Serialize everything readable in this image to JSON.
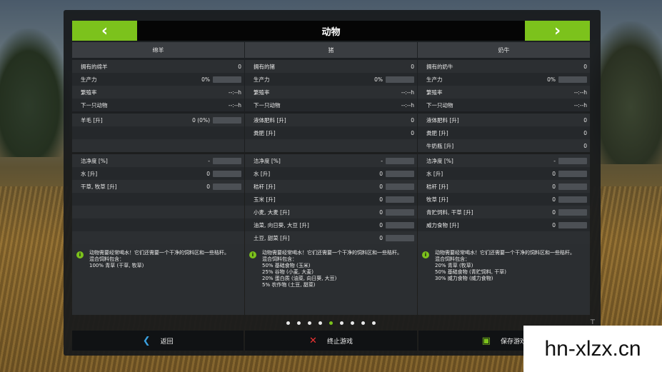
{
  "header": {
    "title": "动物",
    "prev_glyph": "‹",
    "next_glyph": "›"
  },
  "columns": [
    {
      "name": "绵羊",
      "stats": [
        {
          "label": "拥有的绵羊",
          "value": "0",
          "bar": false
        },
        {
          "label": "生产力",
          "value": "0%",
          "bar": true
        },
        {
          "label": "繁殖率",
          "value": "--:--h",
          "bar": false
        },
        {
          "label": "下一只动物",
          "value": "--:--h",
          "bar": false
        }
      ],
      "products": [
        {
          "label": "羊毛 [升]",
          "value": "0 (0%)",
          "bar": true
        }
      ],
      "inputs": [
        {
          "label": "洁净度 [%]",
          "value": "-",
          "bar": true
        },
        {
          "label": "水 [升]",
          "value": "0",
          "bar": true
        },
        {
          "label": "干草, 牧草 [升]",
          "value": "0",
          "bar": true
        }
      ],
      "info": "动物需要经常喝水！它们还需要一个干净的饲料区和一些秸秆。\n混合饲料包含：\n100% 青草 (干草, 牧草)"
    },
    {
      "name": "猪",
      "stats": [
        {
          "label": "拥有的猪",
          "value": "0",
          "bar": false
        },
        {
          "label": "生产力",
          "value": "0%",
          "bar": true
        },
        {
          "label": "繁殖率",
          "value": "--:--h",
          "bar": false
        },
        {
          "label": "下一只动物",
          "value": "--:--h",
          "bar": false
        }
      ],
      "products": [
        {
          "label": "液体肥料 [升]",
          "value": "0",
          "bar": false
        },
        {
          "label": "粪肥 [升]",
          "value": "0",
          "bar": false
        }
      ],
      "inputs": [
        {
          "label": "洁净度 [%]",
          "value": "-",
          "bar": true
        },
        {
          "label": "水 [升]",
          "value": "0",
          "bar": true
        },
        {
          "label": "秸秆 [升]",
          "value": "0",
          "bar": true
        },
        {
          "label": "玉米 [升]",
          "value": "0",
          "bar": true
        },
        {
          "label": "小麦, 大麦 [升]",
          "value": "0",
          "bar": true
        },
        {
          "label": "油菜, 向日葵, 大豆 [升]",
          "value": "0",
          "bar": true
        },
        {
          "label": "土豆, 甜菜 [升]",
          "value": "0",
          "bar": true
        }
      ],
      "info": "动物需要经常喝水！它们还需要一个干净的饲料区和一些秸秆。\n混合饲料包含：\n50% 基础食物 (玉米)\n25% 谷物 (小麦, 大麦)\n20% 蛋白质 (油菜, 向日葵, 大豆)\n5% 农作物 (土豆, 甜菜)"
    },
    {
      "name": "奶牛",
      "stats": [
        {
          "label": "拥有的奶牛",
          "value": "0",
          "bar": false
        },
        {
          "label": "生产力",
          "value": "0%",
          "bar": true
        },
        {
          "label": "繁殖率",
          "value": "--:--h",
          "bar": false
        },
        {
          "label": "下一只动物",
          "value": "--:--h",
          "bar": false
        }
      ],
      "products": [
        {
          "label": "液体肥料 [升]",
          "value": "0",
          "bar": false
        },
        {
          "label": "粪肥 [升]",
          "value": "0",
          "bar": false
        },
        {
          "label": "牛奶瓶 [升]",
          "value": "0",
          "bar": false
        }
      ],
      "inputs": [
        {
          "label": "洁净度 [%]",
          "value": "-",
          "bar": true
        },
        {
          "label": "水 [升]",
          "value": "0",
          "bar": true
        },
        {
          "label": "秸秆 [升]",
          "value": "0",
          "bar": true
        },
        {
          "label": "牧草 [升]",
          "value": "0",
          "bar": true
        },
        {
          "label": "青贮饲料, 干草 [升]",
          "value": "0",
          "bar": true
        },
        {
          "label": "威力食物 [升]",
          "value": "0",
          "bar": true
        }
      ],
      "info": "动物需要经常喝水！它们还需要一个干净的饲料区和一些秸秆。\n混合饲料包含：\n20% 青草 (牧草)\n50% 基础食物 (青贮饲料, 干草)\n30% 威力食物 (威力食物)"
    }
  ],
  "pagination": {
    "count": 9,
    "active_index": 4
  },
  "footer": {
    "back_label": "返回",
    "quit_label": "终止游戏",
    "save_label": "保存游戏"
  },
  "info_icon_glyph": "i",
  "watermark": "hn-xlzx.cn",
  "colors": {
    "accent": "#7cc21c",
    "back_icon": "#3aa0e0",
    "quit_icon": "#ee3333"
  }
}
